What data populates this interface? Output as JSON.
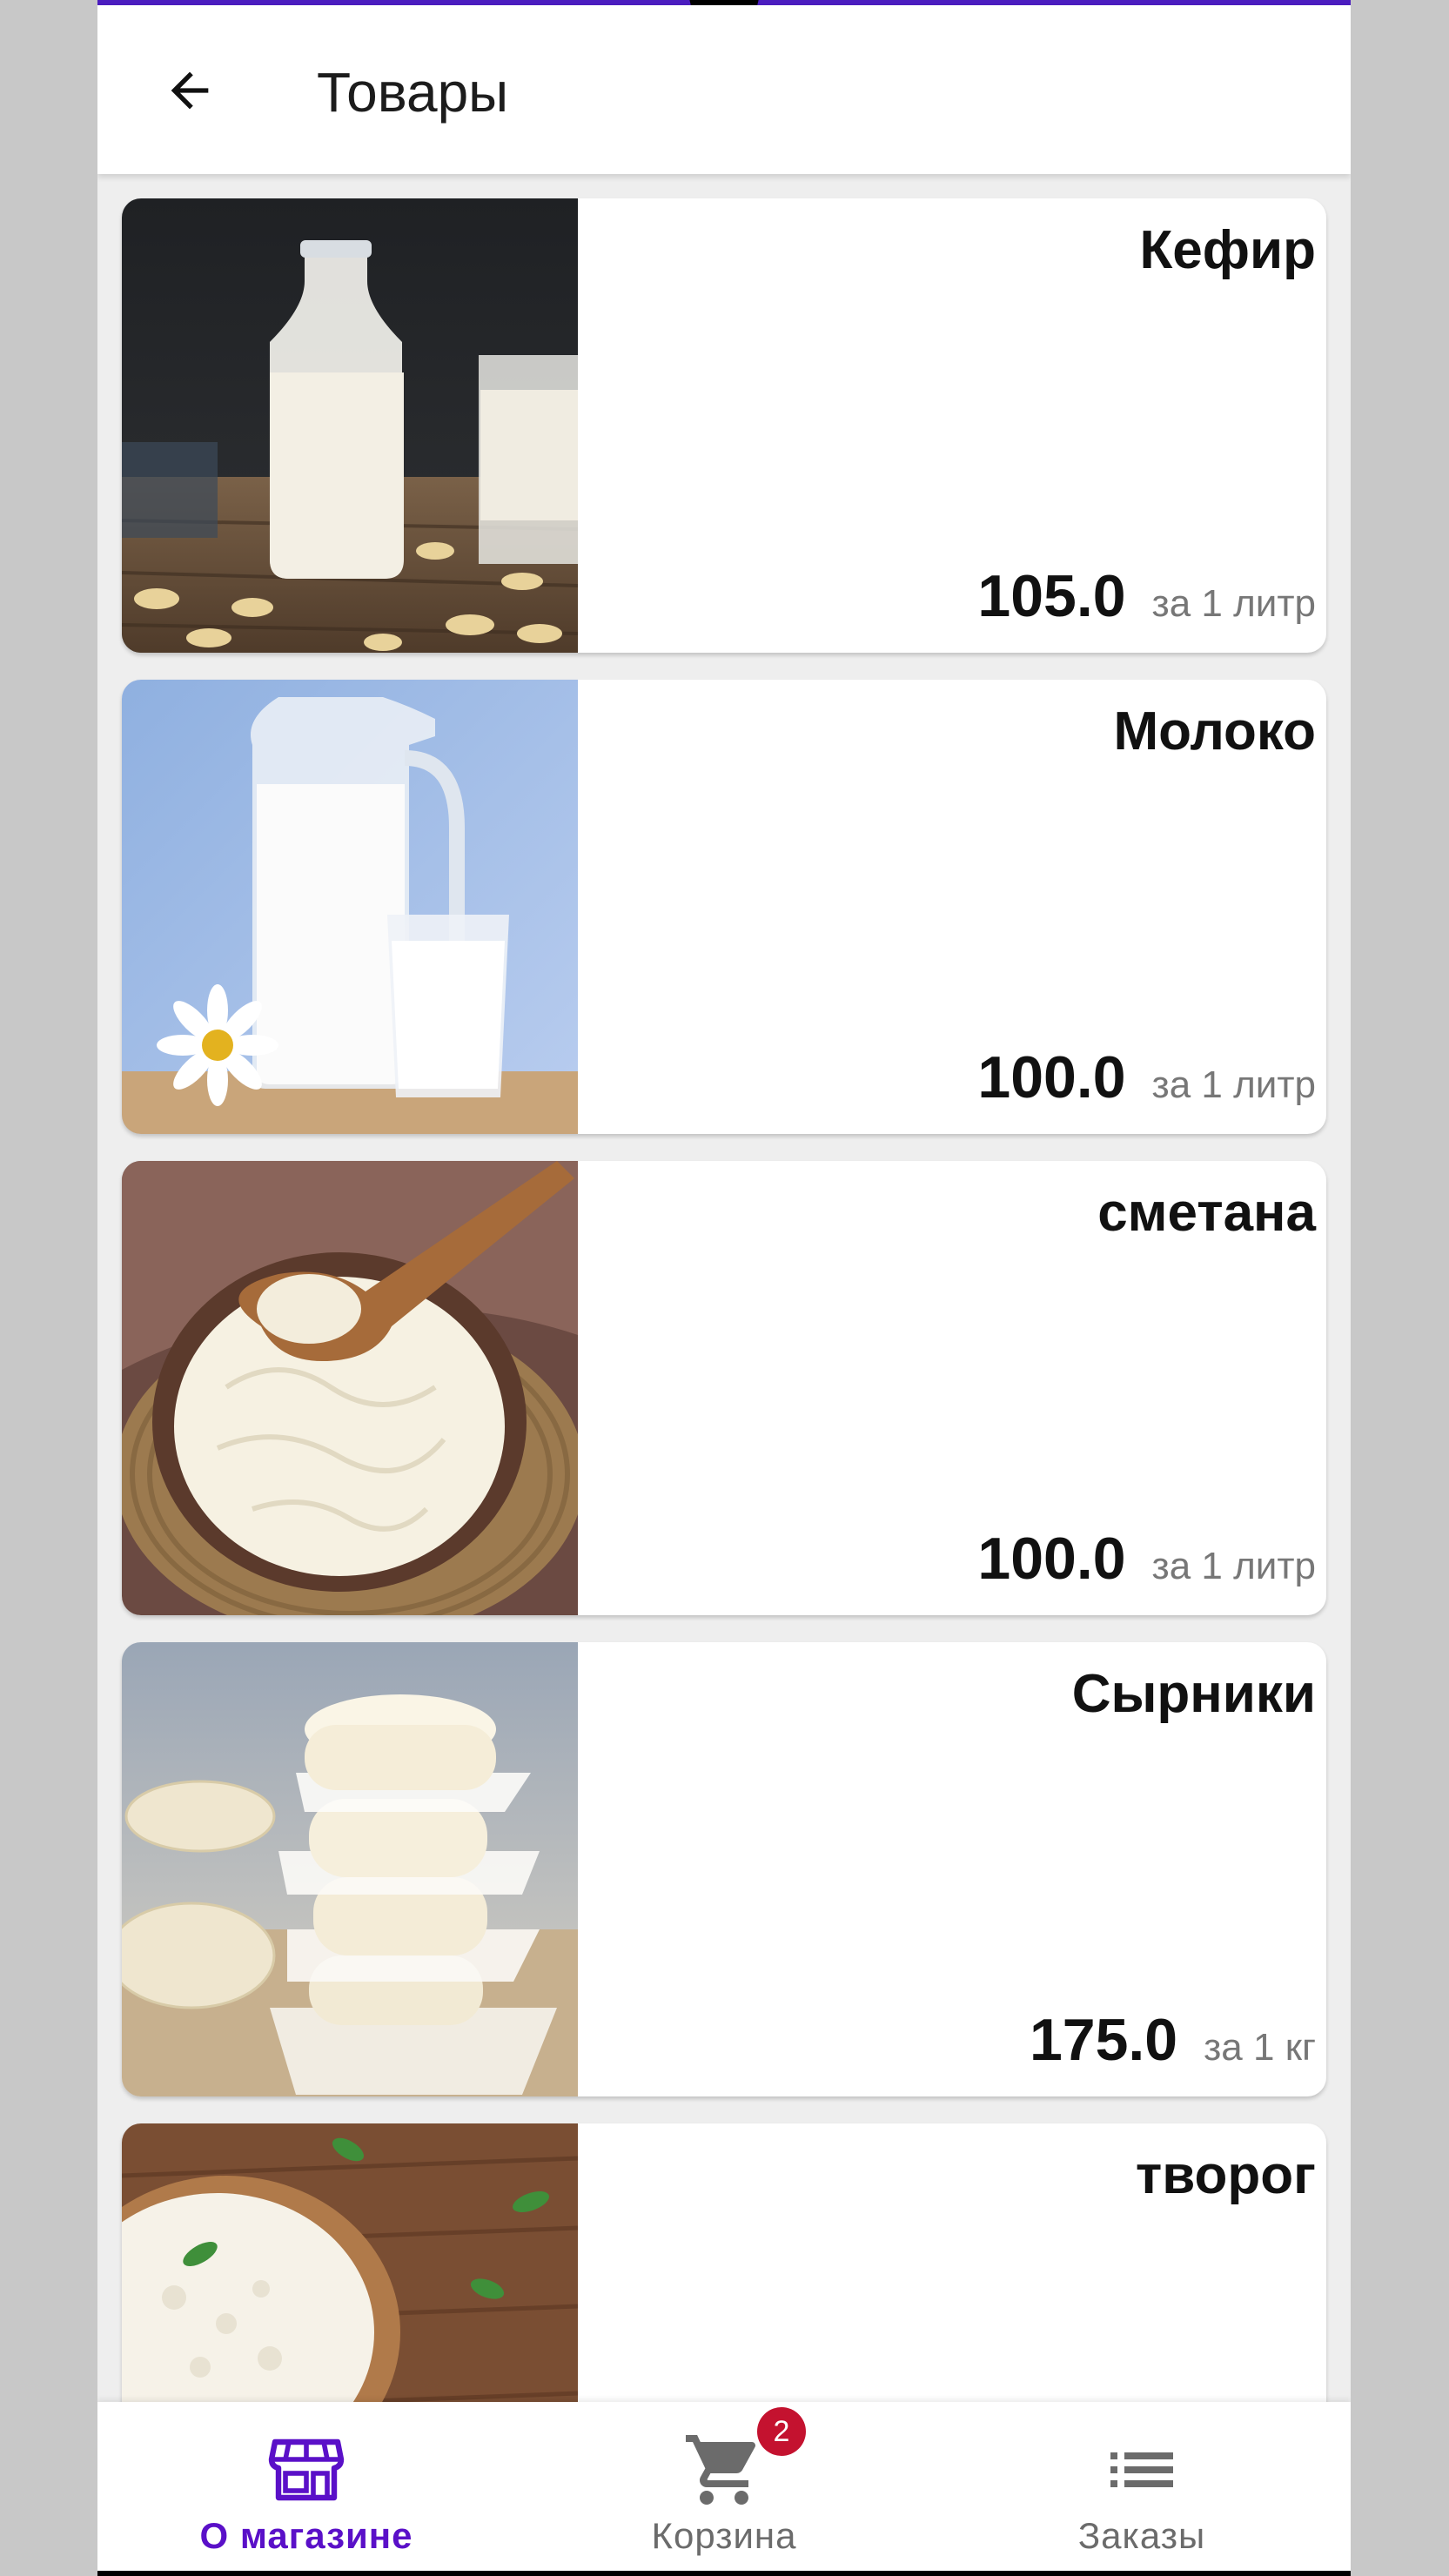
{
  "header": {
    "title": "Товары"
  },
  "products": [
    {
      "name": "Кефир",
      "price": "105.0",
      "unit": "за 1 литр"
    },
    {
      "name": "Молоко",
      "price": "100.0",
      "unit": "за 1 литр"
    },
    {
      "name": "сметана",
      "price": "100.0",
      "unit": "за 1 литр"
    },
    {
      "name": "Сырники",
      "price": "175.0",
      "unit": "за 1 кг"
    },
    {
      "name": "творог"
    }
  ],
  "bottom_nav": {
    "items": [
      {
        "label": "О магазине",
        "icon": "storefront-icon",
        "active": true
      },
      {
        "label": "Корзина",
        "icon": "cart-icon",
        "badge": "2"
      },
      {
        "label": "Заказы",
        "icon": "list-icon"
      }
    ]
  },
  "colors": {
    "accent": "#5a10c8",
    "badge": "#c4122f",
    "topline": "#4b1dbf"
  }
}
